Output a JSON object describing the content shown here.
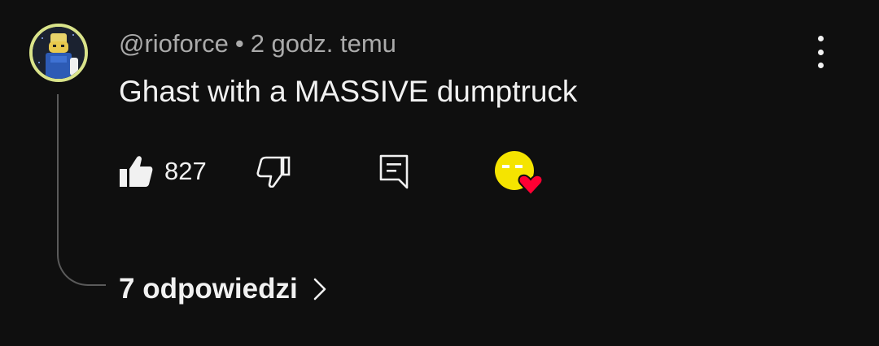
{
  "comment": {
    "author": "@rioforce",
    "separator": "•",
    "time": "2 godz. temu",
    "text": "Ghast with a MASSIVE dumptruck"
  },
  "actions": {
    "like_count": "827",
    "like_icon": "thumb-up-icon",
    "dislike_icon": "thumb-down-icon",
    "reply_icon": "reply-icon",
    "creator_heart": "creator-heart-icon"
  },
  "replies": {
    "label": "7 odpowiedzi",
    "icon": "chevron-right-icon"
  },
  "colors": {
    "background": "#0f0f0f",
    "primary_text": "#f1f1f1",
    "secondary_text": "#aaaaaa",
    "thread_line": "#5a5a5a",
    "avatar_ring": "#d9e38a",
    "heart": "#ff0033",
    "creator_face": "#f5e400"
  }
}
